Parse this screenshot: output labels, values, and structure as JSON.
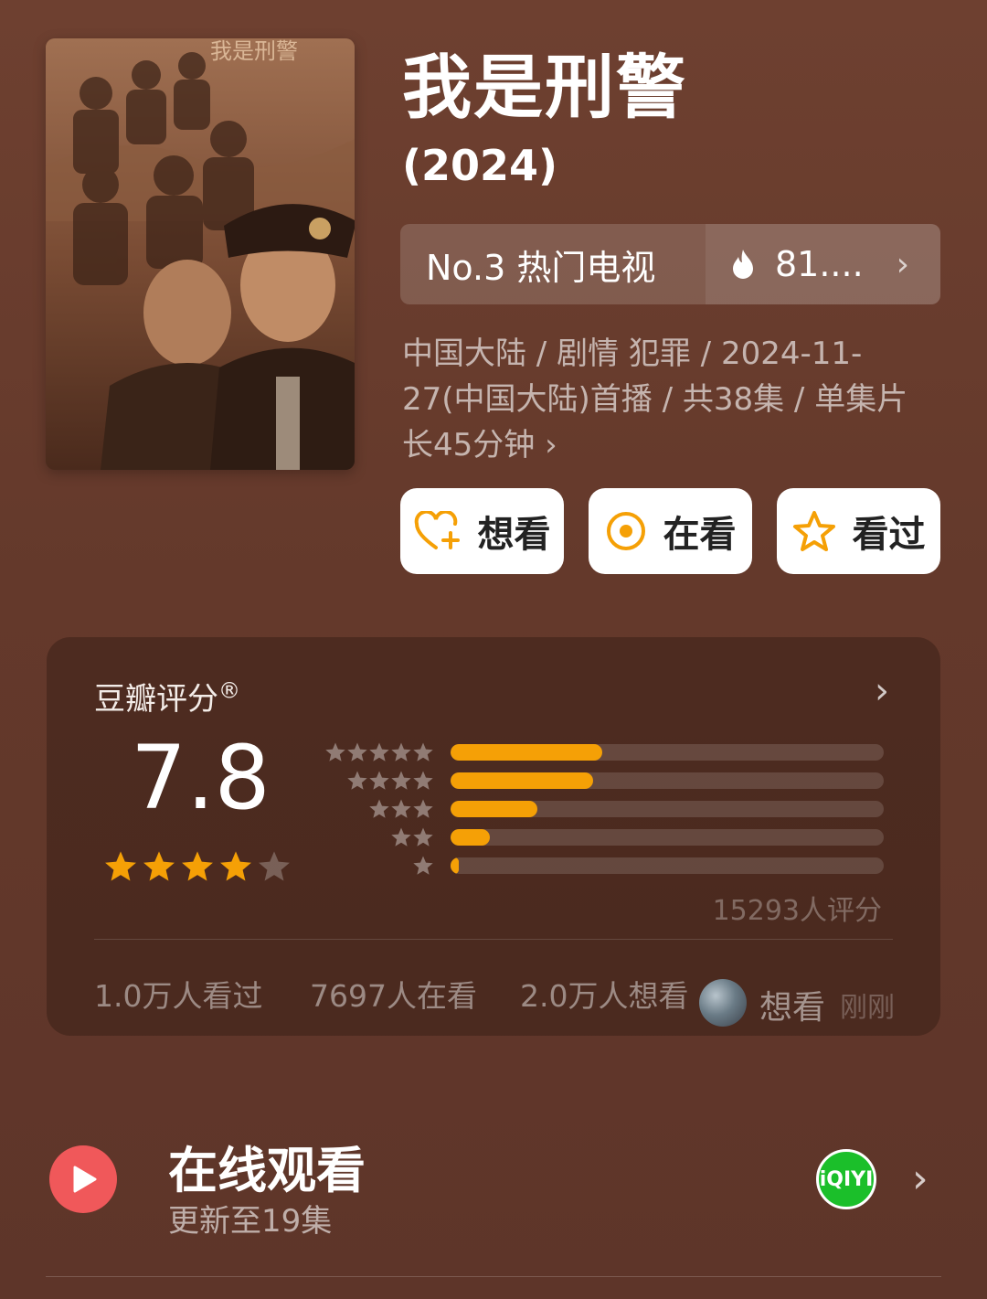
{
  "title": "我是刑警",
  "year": "(2024)",
  "ranking": {
    "label": "No.3 热门电视",
    "heat": "81....",
    "chevron": "›"
  },
  "meta": "中国大陆 / 剧情 犯罪 / 2024-11-27(中国大陆)首播 / 共38集 / 单集片长45分钟 ›",
  "actions": {
    "want": "想看",
    "watching": "在看",
    "watched": "看过"
  },
  "rating": {
    "label": "豆瓣评分",
    "reg": "®",
    "score": "7.8",
    "score_stars": 4,
    "distribution": [
      {
        "stars": 5,
        "fraction": 0.35
      },
      {
        "stars": 4,
        "fraction": 0.33
      },
      {
        "stars": 3,
        "fraction": 0.2
      },
      {
        "stars": 2,
        "fraction": 0.09
      },
      {
        "stars": 1,
        "fraction": 0.02
      }
    ],
    "votes": "15293人评分",
    "stats": {
      "watched": "1.0万人看过",
      "watching": "7697人在看",
      "want": "2.0万人想看"
    },
    "recent": {
      "action": "想看",
      "time": "刚刚"
    }
  },
  "watch_online": {
    "title": "在线观看",
    "subtitle": "更新至19集",
    "platform_icon": "iqiyi-logo"
  },
  "colors": {
    "background": "#6b3f30",
    "accent": "#f5a006",
    "play": "#f0585a",
    "iqiyi": "#1bbf2a"
  }
}
